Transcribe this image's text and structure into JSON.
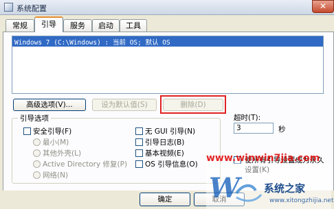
{
  "window": {
    "title": "系统配置",
    "close_glyph": "✕"
  },
  "tabs": [
    "常规",
    "引导",
    "服务",
    "启动",
    "工具"
  ],
  "boot_list": {
    "entries": [
      "Windows 7 (C:\\Windows) : 当前 OS; 默认 OS"
    ]
  },
  "buttons": {
    "advanced": "高级选项(V)...",
    "set_default": "设为默认值(S)",
    "delete": "删除(D)",
    "ok": "确定",
    "cancel": "取消"
  },
  "boot_options": {
    "legend": "引导选项",
    "safe_boot": "安全引导(F)",
    "minimal": "最小(M)",
    "alternate_shell": "其他外壳(L)",
    "active_directory": "Active Directory 修复(P)",
    "network": "网络(N)",
    "no_gui": "无 GUI 引导(N)",
    "boot_log": "引导日志(B)",
    "base_video": "基本视频(E)",
    "os_boot_info": "OS 引导信息(O)"
  },
  "timeout": {
    "label": "超时(T):",
    "value": "3",
    "unit": "秒"
  },
  "permanent": {
    "text_line1": "使所有引导设置成为永久",
    "text_line2": "设置(K)"
  },
  "watermark": {
    "url": "www.winwin7jia.com",
    "brand": "系统之家",
    "sub": "www.xitongzhijia.net"
  },
  "colors": {
    "selection": "#316ac5",
    "highlight_box": "#e02020",
    "tab_accent": "#e68b2c"
  }
}
